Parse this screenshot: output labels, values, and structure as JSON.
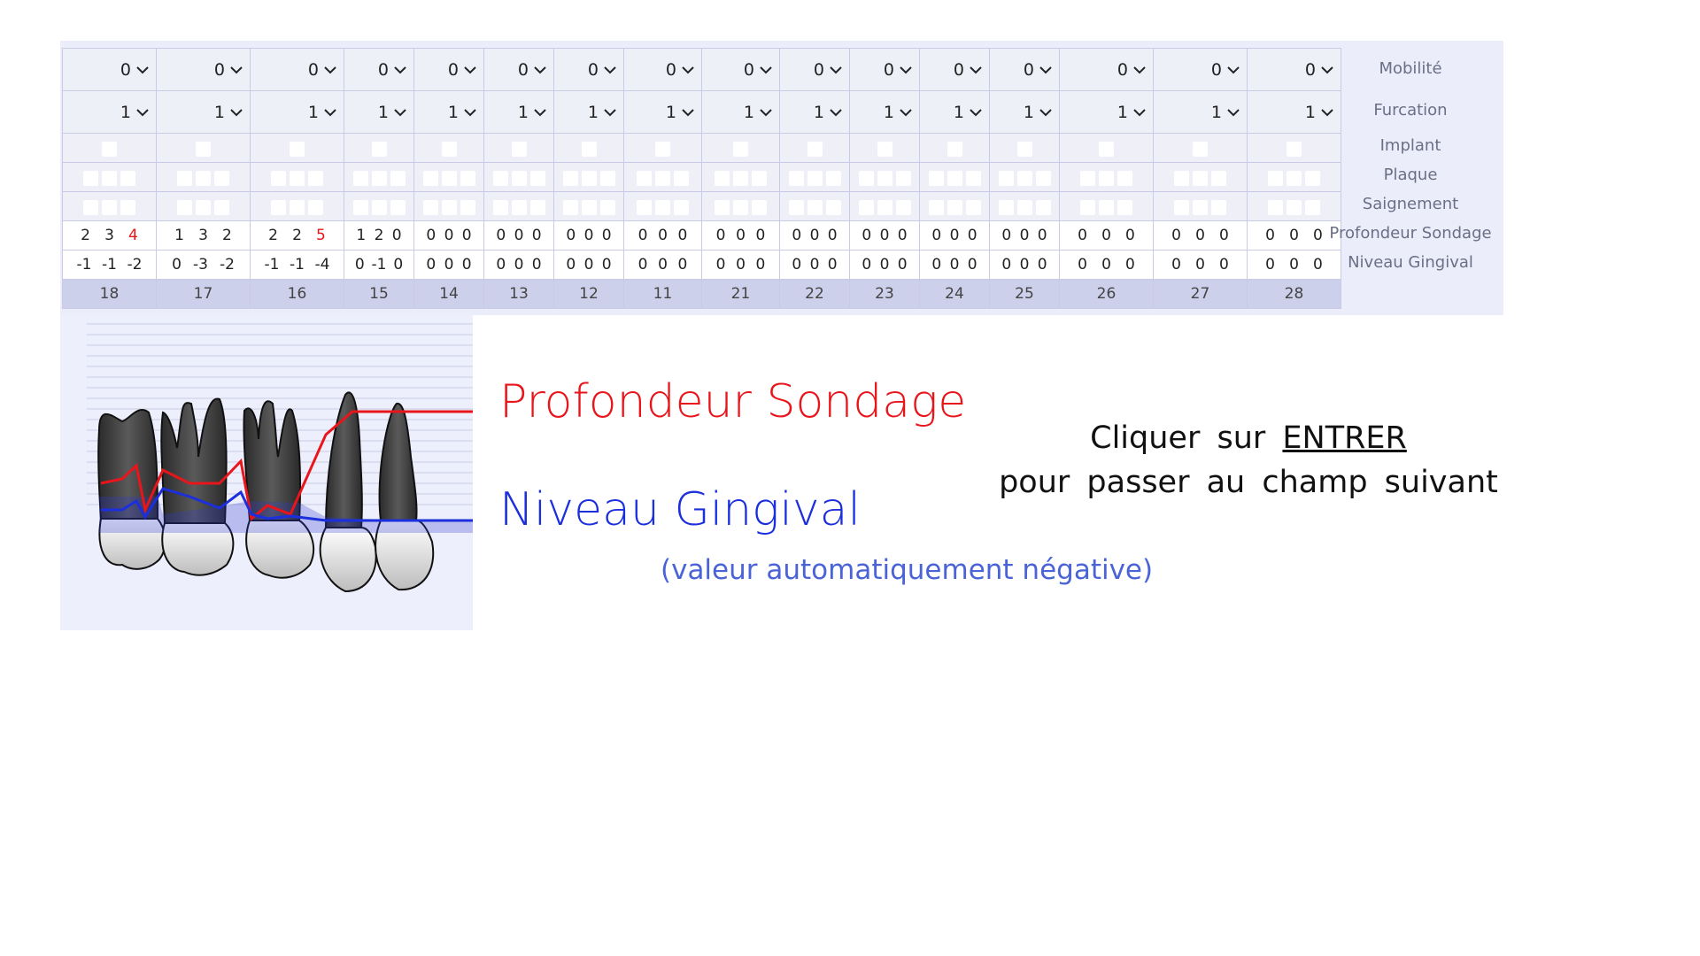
{
  "rows": {
    "mobilite_label": "Mobilité",
    "furcation_label": "Furcation",
    "implant_label": "Implant",
    "plaque_label": "Plaque",
    "saignement_label": "Saignement",
    "profondeur_label": "Profondeur Sondage",
    "niveau_label": "Niveau Gingival"
  },
  "teeth": [
    {
      "num": "18",
      "mob": "0",
      "fur": "1",
      "prof": [
        "2",
        "3",
        "4"
      ],
      "niv": [
        "-1",
        "-1",
        "-2"
      ]
    },
    {
      "num": "17",
      "mob": "0",
      "fur": "1",
      "prof": [
        "1",
        "3",
        "2"
      ],
      "niv": [
        "0",
        "-3",
        "-2"
      ]
    },
    {
      "num": "16",
      "mob": "0",
      "fur": "1",
      "prof": [
        "2",
        "2",
        "5"
      ],
      "niv": [
        "-1",
        "-1",
        "-4"
      ]
    },
    {
      "num": "15",
      "mob": "0",
      "fur": "1",
      "prof": [
        "1",
        "2",
        "0"
      ],
      "niv": [
        "0",
        "-1",
        "0"
      ]
    },
    {
      "num": "14",
      "mob": "0",
      "fur": "1",
      "prof": [
        "0",
        "0",
        "0"
      ],
      "niv": [
        "0",
        "0",
        "0"
      ]
    },
    {
      "num": "13",
      "mob": "0",
      "fur": "1",
      "prof": [
        "0",
        "0",
        "0"
      ],
      "niv": [
        "0",
        "0",
        "0"
      ]
    },
    {
      "num": "12",
      "mob": "0",
      "fur": "1",
      "prof": [
        "0",
        "0",
        "0"
      ],
      "niv": [
        "0",
        "0",
        "0"
      ]
    },
    {
      "num": "11",
      "mob": "0",
      "fur": "1",
      "prof": [
        "0",
        "0",
        "0"
      ],
      "niv": [
        "0",
        "0",
        "0"
      ]
    },
    {
      "num": "21",
      "mob": "0",
      "fur": "1",
      "prof": [
        "0",
        "0",
        "0"
      ],
      "niv": [
        "0",
        "0",
        "0"
      ]
    },
    {
      "num": "22",
      "mob": "0",
      "fur": "1",
      "prof": [
        "0",
        "0",
        "0"
      ],
      "niv": [
        "0",
        "0",
        "0"
      ]
    },
    {
      "num": "23",
      "mob": "0",
      "fur": "1",
      "prof": [
        "0",
        "0",
        "0"
      ],
      "niv": [
        "0",
        "0",
        "0"
      ]
    },
    {
      "num": "24",
      "mob": "0",
      "fur": "1",
      "prof": [
        "0",
        "0",
        "0"
      ],
      "niv": [
        "0",
        "0",
        "0"
      ]
    },
    {
      "num": "25",
      "mob": "0",
      "fur": "1",
      "prof": [
        "0",
        "0",
        "0"
      ],
      "niv": [
        "0",
        "0",
        "0"
      ]
    },
    {
      "num": "26",
      "mob": "0",
      "fur": "1",
      "prof": [
        "0",
        "0",
        "0"
      ],
      "niv": [
        "0",
        "0",
        "0"
      ]
    },
    {
      "num": "27",
      "mob": "0",
      "fur": "1",
      "prof": [
        "0",
        "0",
        "0"
      ],
      "niv": [
        "0",
        "0",
        "0"
      ]
    },
    {
      "num": "28",
      "mob": "0",
      "fur": "1",
      "prof": [
        "0",
        "0",
        "0"
      ],
      "niv": [
        "0",
        "0",
        "0"
      ]
    }
  ],
  "highlight_values": {
    "18": [
      2
    ],
    "16": [
      2
    ]
  },
  "legend": {
    "profondeur": "Profondeur Sondage",
    "niveau": "Niveau Gingival",
    "niveau_note": "(valeur automatiquement négative)"
  },
  "instruction": {
    "line1_prefix": "Cliquer sur",
    "line1_key": "ENTRER",
    "line2": "pour passer au champ suivant"
  },
  "colors": {
    "profondeur_line": "#e8151b",
    "niveau_line": "#1b2fdc",
    "panel_bg": "#ecedfb",
    "header_row_bg": "#cdd0ea"
  },
  "icons": {
    "select_arrow": "chevron-down-icon"
  }
}
